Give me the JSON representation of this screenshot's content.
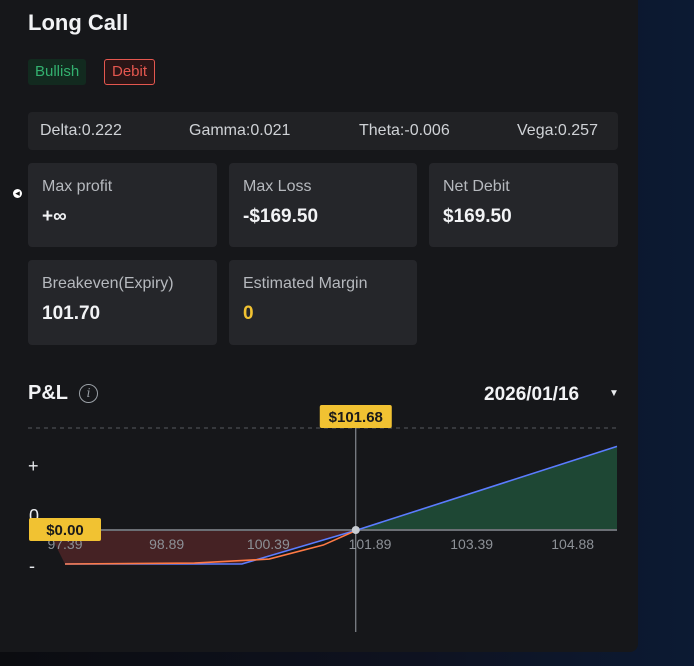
{
  "strategy": {
    "title": "Long Call",
    "tags": [
      "Bullish",
      "Debit"
    ]
  },
  "greeks": {
    "delta": "Delta:0.222",
    "gamma": "Gamma:0.021",
    "theta": "Theta:-0.006",
    "vega": "Vega:0.257"
  },
  "metrics": {
    "max_profit": {
      "label": "Max profit",
      "value": "+∞"
    },
    "max_loss": {
      "label": "Max Loss",
      "value": "-$169.50"
    },
    "net_debit": {
      "label": "Net Debit",
      "value": "$169.50"
    },
    "breakeven": {
      "label": "Breakeven(Expiry)",
      "value": "101.70"
    },
    "margin": {
      "label": "Estimated Margin",
      "value": "0"
    }
  },
  "pnl": {
    "title": "P&L",
    "info_icon": "info-icon",
    "date": "2026/01/16",
    "caret_icon": "caret-down-icon",
    "y_plus": "+",
    "y_zero": "0",
    "y_minus": "-",
    "cursor_price_label": "$101.68",
    "cursor_pnl_label": "$0.00"
  },
  "chart_data": {
    "type": "area",
    "x_ticks": [
      "97.39",
      "98.89",
      "100.39",
      "101.89",
      "103.39",
      "104.88"
    ],
    "x_range": [
      97.39,
      105.88
    ],
    "strike": 100.0,
    "breakeven": 101.7,
    "max_loss": -169.5,
    "cursor_price": 101.68,
    "series": [
      {
        "name": "",
        "color": "#5b7cff",
        "x": [
          97.39,
          100.0,
          101.7,
          105.88
        ],
        "y": [
          -169.5,
          -169.5,
          0,
          417
        ]
      },
      {
        "name": "",
        "color": "#ff7a45",
        "x": [
          97.39,
          99.3,
          100.4,
          101.2,
          101.7
        ],
        "y": [
          -169.5,
          -165,
          -145,
          -75,
          0
        ]
      }
    ],
    "colors": {
      "profit_fill": "#1f4a36",
      "loss_fill": "#4a2326",
      "zero_line": "#6b6f75"
    }
  }
}
